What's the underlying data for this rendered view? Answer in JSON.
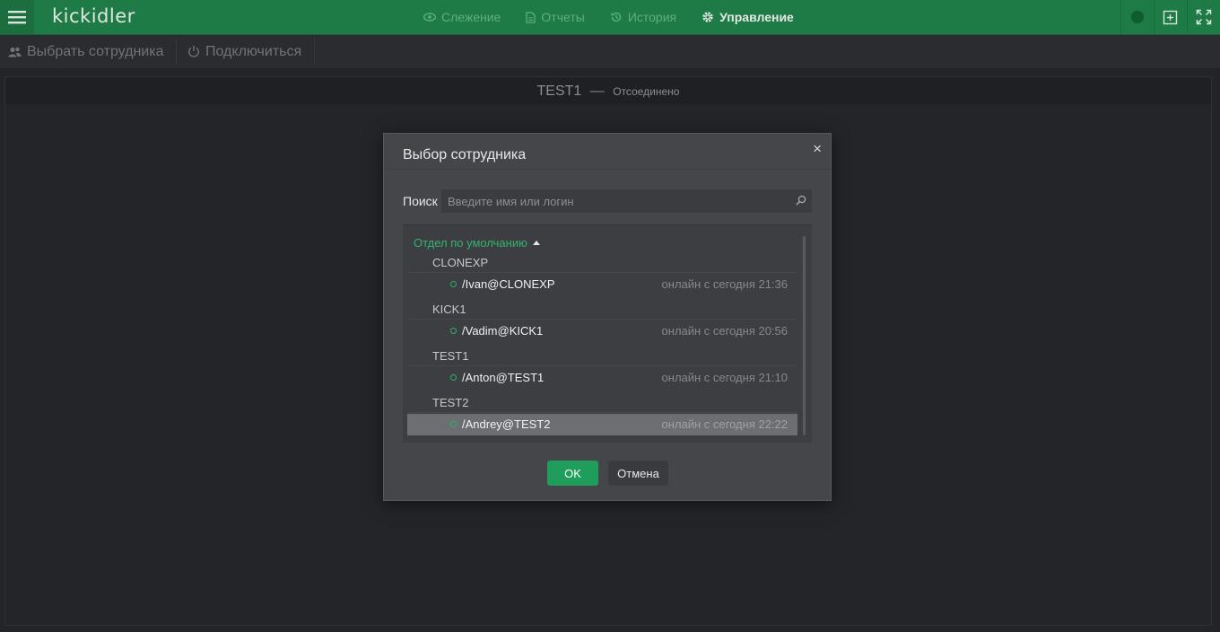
{
  "app": {
    "logo": "kickidler"
  },
  "nav": [
    {
      "label": "Слежение",
      "icon": "eye-icon",
      "active": false
    },
    {
      "label": "Отчеты",
      "icon": "document-icon",
      "active": false
    },
    {
      "label": "История",
      "icon": "history-icon",
      "active": false
    },
    {
      "label": "Управление",
      "icon": "gear-icon",
      "active": true
    }
  ],
  "toolbar": {
    "select_employee": "Выбрать сотрудника",
    "connect": "Подключиться"
  },
  "panel": {
    "name": "TEST1",
    "dash": "—",
    "status": "Отсоединено"
  },
  "dialog": {
    "title": "Выбор сотрудника",
    "close_glyph": "×",
    "search_label": "Поиск",
    "search_placeholder": "Введите имя или логин",
    "department": "Отдел по умолчанию",
    "groups": [
      {
        "name": "CLONEXP",
        "users": [
          {
            "name": "/Ivan@CLONEXP",
            "status": "онлайн с сегодня 21:36",
            "selected": false
          }
        ]
      },
      {
        "name": "KICK1",
        "users": [
          {
            "name": "/Vadim@KICK1",
            "status": "онлайн с сегодня 20:56",
            "selected": false
          }
        ]
      },
      {
        "name": "TEST1",
        "users": [
          {
            "name": "/Anton@TEST1",
            "status": "онлайн с сегодня 21:10",
            "selected": false
          }
        ]
      },
      {
        "name": "TEST2",
        "users": [
          {
            "name": "/Andrey@TEST2",
            "status": "онлайн с сегодня 22:22",
            "selected": true
          }
        ]
      }
    ],
    "ok_label": "OK",
    "cancel_label": "Отмена"
  },
  "colors": {
    "brand": "#1e7b45",
    "accent": "#1f9d5a",
    "online": "#2fb06b"
  }
}
